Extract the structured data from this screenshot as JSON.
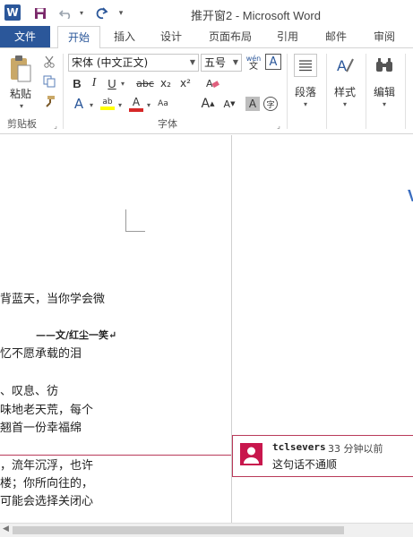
{
  "window": {
    "title": "推开窗2 - Microsoft Word",
    "app_logo": "W"
  },
  "quick_access": {
    "save_icon": "save-icon",
    "undo_icon": "undo-icon",
    "redo_icon": "redo-icon",
    "customize_icon": "customize-icon"
  },
  "tabs": {
    "file": "文件",
    "items": [
      "开始",
      "插入",
      "设计",
      "页面布局",
      "引用",
      "邮件",
      "审阅"
    ],
    "active": "开始"
  },
  "ribbon": {
    "clipboard": {
      "paste_label": "粘贴",
      "group_label": "剪贴板"
    },
    "font": {
      "font_name": "宋体 (中文正文)",
      "font_size": "五号",
      "phonetic_top": "wén",
      "phonetic_bottom": "文",
      "border_char": "A",
      "bold": "B",
      "italic": "I",
      "underline": "U",
      "strikethrough": "abc",
      "subscript": "x₂",
      "superscript": "x²",
      "highlight": "ab",
      "font_color": "A",
      "grow": "A",
      "shrink": "A",
      "shade_char": "A",
      "enclosed_char": "字",
      "text_effect": "A",
      "group_label": "字体"
    },
    "paragraph": {
      "label": "段落"
    },
    "styles": {
      "label": "样式"
    },
    "editing": {
      "label": "编辑"
    }
  },
  "document": {
    "lines": [
      "背蓝天，当你学会微",
      "——文/红尘一笑↵",
      "忆不愿承载的泪",
      "、叹息、彷",
      "味地老天荒，每个",
      "翘首一份幸福绵",
      "，流年沉浮，也许",
      "楼；你所向往的，",
      "可能会选择关闭心"
    ]
  },
  "comment": {
    "author": "tclsevers",
    "time": "33 分钟以前",
    "text": "这句话不通顺"
  },
  "colors": {
    "accent": "#2b579a",
    "comment_border": "#b93a5a",
    "avatar": "#c8174d"
  }
}
